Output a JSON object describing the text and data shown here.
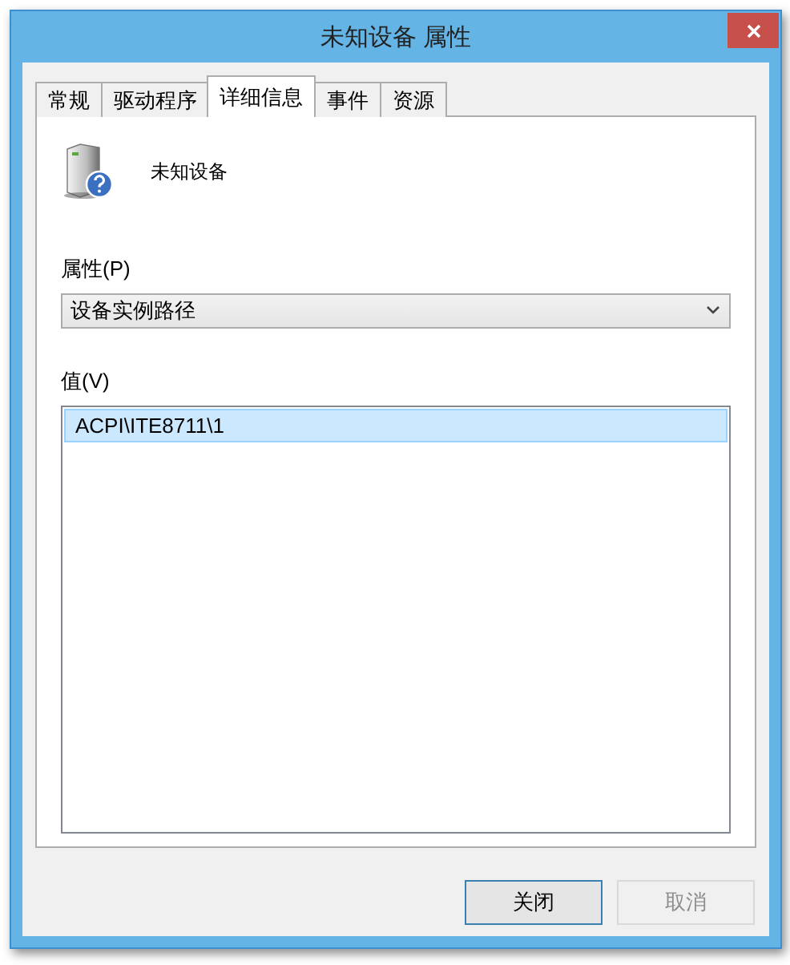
{
  "window": {
    "title": "未知设备 属性"
  },
  "tabs": [
    {
      "label": "常规",
      "selected": false
    },
    {
      "label": "驱动程序",
      "selected": false
    },
    {
      "label": "详细信息",
      "selected": true
    },
    {
      "label": "事件",
      "selected": false
    },
    {
      "label": "资源",
      "selected": false
    }
  ],
  "device": {
    "name": "未知设备"
  },
  "property": {
    "label": "属性(P)",
    "value": "设备实例路径"
  },
  "values": {
    "label": "值(V)",
    "items": [
      {
        "text": "ACPI\\ITE8711\\1",
        "selected": true
      }
    ]
  },
  "buttons": [
    {
      "label": "关闭",
      "disabled": false,
      "default": true
    },
    {
      "label": "取消",
      "disabled": true,
      "default": false
    }
  ]
}
